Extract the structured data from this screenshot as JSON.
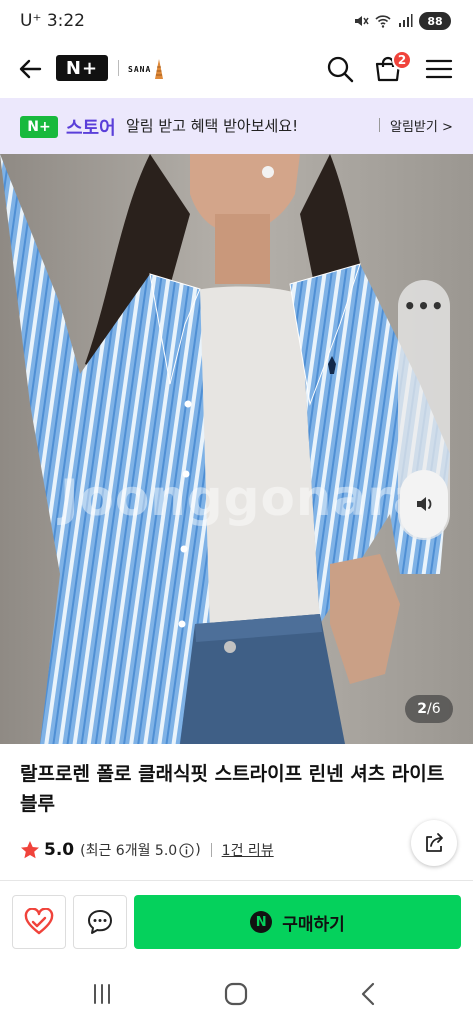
{
  "status": {
    "carrier": "U⁺ 3:22",
    "battery": "88",
    "icons": [
      "mute-icon",
      "wifi-icon",
      "signal-icon",
      "battery-icon"
    ]
  },
  "header": {
    "logo": "N+",
    "brand_logo_text": "SANA",
    "cart_count": "2",
    "icons": [
      "back-arrow-icon",
      "search-icon",
      "cart-icon",
      "hamburger-menu-icon"
    ]
  },
  "promo": {
    "badge": "N+",
    "store_label": "스토어",
    "text": "알림 받고 혜택 받아보세요!",
    "action": "알림받기 >"
  },
  "gallery": {
    "watermark": "Joonggonara",
    "current": "2",
    "separator": "/",
    "total": "6",
    "more_label": "•••"
  },
  "product": {
    "title": "랄프로렌 폴로 클래식핏 스트라이프 린넨 셔츠 라이트 블루",
    "rating": "5.0",
    "rating_period": "(최근 6개월 5.0",
    "rating_period_close": ")",
    "review_link": "1건 리뷰"
  },
  "actions": {
    "buy_icon": "N",
    "buy_label": "구매하기"
  },
  "colors": {
    "accent_green": "#05d15c",
    "promo_purple": "#5a3fd9",
    "promo_bg": "#ece8fc",
    "badge_red": "#f0433b",
    "star_red": "#f0433b"
  }
}
